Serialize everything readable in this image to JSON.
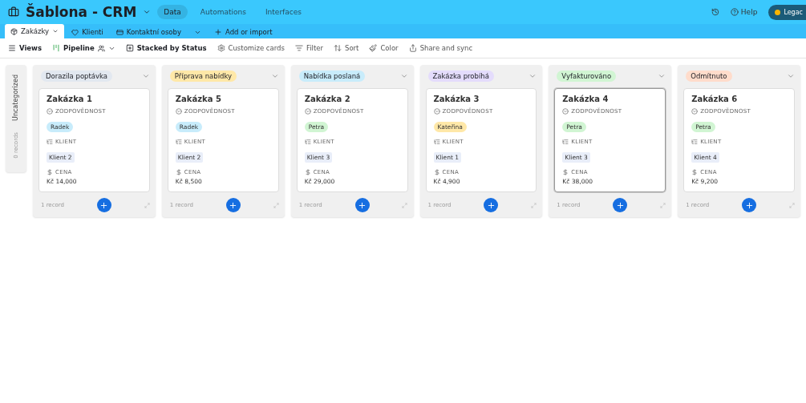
{
  "app": {
    "title": "Šablona - CRM",
    "nav": [
      {
        "label": "Data",
        "selected": true
      },
      {
        "label": "Automations",
        "selected": false
      },
      {
        "label": "Interfaces",
        "selected": false
      }
    ],
    "help": "Help",
    "badge": "Legac"
  },
  "tables": [
    {
      "label": "Zakázky",
      "selected": true
    },
    {
      "label": "Klienti",
      "selected": false
    },
    {
      "label": "Kontaktní osoby",
      "selected": false
    }
  ],
  "add_import": "Add or import",
  "toolbar": {
    "views": "Views",
    "view_name": "Pipeline",
    "stacked": "Stacked by Status",
    "tools": [
      "Customize cards",
      "Filter",
      "Sort",
      "Color",
      "Share and sync"
    ]
  },
  "uncategorized": {
    "title": "Uncategorized",
    "count": "0 records"
  },
  "columns": [
    {
      "status": "Dorazila poptávka",
      "color": "#e2e8f0",
      "footer": "1 record",
      "cards": [
        {
          "title": "Zakázka 1",
          "selected": false,
          "fields": [
            {
              "kind": "person",
              "label": "ZODPOVĚDNOST",
              "value": "Radek",
              "color": "#c8ecfb"
            },
            {
              "kind": "link",
              "label": "KLIENT",
              "value": "Klient 2"
            },
            {
              "kind": "money",
              "label": "CENA",
              "value": "Kč 14,000"
            }
          ]
        }
      ]
    },
    {
      "status": "Příprava nabídky",
      "color": "#ffe8a8",
      "footer": "1 record",
      "cards": [
        {
          "title": "Zakázka 5",
          "selected": false,
          "fields": [
            {
              "kind": "person",
              "label": "ZODPOVĚDNOST",
              "value": "Radek",
              "color": "#c8ecfb"
            },
            {
              "kind": "link",
              "label": "KLIENT",
              "value": "Klient 2"
            },
            {
              "kind": "money",
              "label": "CENA",
              "value": "Kč 8,500"
            }
          ]
        }
      ]
    },
    {
      "status": "Nabídka poslaná",
      "color": "#c8ecfb",
      "footer": "1 record",
      "cards": [
        {
          "title": "Zakázka 2",
          "selected": false,
          "fields": [
            {
              "kind": "person",
              "label": "ZODPOVĚDNOST",
              "value": "Petra",
              "color": "#d1f5d3"
            },
            {
              "kind": "link",
              "label": "KLIENT",
              "value": "Klient 3"
            },
            {
              "kind": "money",
              "label": "CENA",
              "value": "Kč 29,000"
            }
          ]
        }
      ]
    },
    {
      "status": "Zakázka probíhá",
      "color": "#e4dcfc",
      "footer": "1 record",
      "cards": [
        {
          "title": "Zakázka 3",
          "selected": false,
          "fields": [
            {
              "kind": "person",
              "label": "ZODPOVĚDNOST",
              "value": "Kateřina",
              "color": "#ffe8a8"
            },
            {
              "kind": "link",
              "label": "KLIENT",
              "value": "Klient 1"
            },
            {
              "kind": "money",
              "label": "CENA",
              "value": "Kč 4,900"
            }
          ]
        }
      ]
    },
    {
      "status": "Vyfakturováno",
      "color": "#d1f5d3",
      "footer": "1 record",
      "cards": [
        {
          "title": "Zakázka 4",
          "selected": true,
          "fields": [
            {
              "kind": "person",
              "label": "ZODPOVĚDNOST",
              "value": "Petra",
              "color": "#d1f5d3"
            },
            {
              "kind": "link",
              "label": "KLIENT",
              "value": "Klient 3"
            },
            {
              "kind": "money",
              "label": "CENA",
              "value": "Kč 38,000"
            }
          ]
        }
      ]
    },
    {
      "status": "Odmítnuto",
      "color": "#ffdccb",
      "footer": "1 record",
      "cards": [
        {
          "title": "Zakázka 6",
          "selected": false,
          "fields": [
            {
              "kind": "person",
              "label": "ZODPOVĚDNOST",
              "value": "Petra",
              "color": "#d1f5d3"
            },
            {
              "kind": "link",
              "label": "KLIENT",
              "value": "Klient 4"
            },
            {
              "kind": "money",
              "label": "CENA",
              "value": "Kč 9,200"
            }
          ]
        }
      ]
    }
  ]
}
